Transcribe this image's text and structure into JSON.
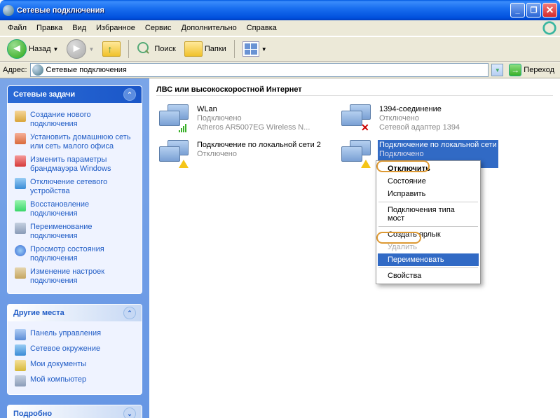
{
  "window": {
    "title": "Сетевые подключения"
  },
  "menu": {
    "file": "Файл",
    "edit": "Правка",
    "view": "Вид",
    "fav": "Избранное",
    "service": "Сервис",
    "extra": "Дополнительно",
    "help": "Справка"
  },
  "toolbar": {
    "back": "Назад",
    "search": "Поиск",
    "folders": "Папки"
  },
  "address": {
    "label": "Адрес:",
    "value": "Сетевые подключения",
    "go": "Переход"
  },
  "sidebar": {
    "tasks_title": "Сетевые задачи",
    "tasks": [
      "Создание нового подключения",
      "Установить домашнюю сеть или сеть малого офиса",
      "Изменить параметры брандмауэра Windows",
      "Отключение сетевого устройства",
      "Восстановление подключения",
      "Переименование подключения",
      "Просмотр состояния подключения",
      "Изменение настроек подключения"
    ],
    "places_title": "Другие места",
    "places": [
      "Панель управления",
      "Сетевое окружение",
      "Мои документы",
      "Мой компьютер"
    ],
    "details_title": "Подробно"
  },
  "content": {
    "section": "ЛВС или высокоскоростной Интернет",
    "conns": [
      {
        "name": "WLan",
        "status": "Подключено",
        "detail": "Atheros AR5007EG Wireless N..."
      },
      {
        "name": "1394-соединение",
        "status": "Отключено",
        "detail": "Сетевой адаптер 1394"
      },
      {
        "name": "Подключение по локальной сети 2",
        "status": "Отключено",
        "detail": ""
      },
      {
        "name": "Подключение по локальной сети",
        "status": "Подключено",
        "detail": ""
      }
    ]
  },
  "ctxmenu": {
    "disable": "Отключить",
    "status": "Состояние",
    "repair": "Исправить",
    "bridge": "Подключения типа мост",
    "shortcut": "Создать ярлык",
    "delete": "Удалить",
    "rename": "Переименовать",
    "props": "Свойства"
  }
}
